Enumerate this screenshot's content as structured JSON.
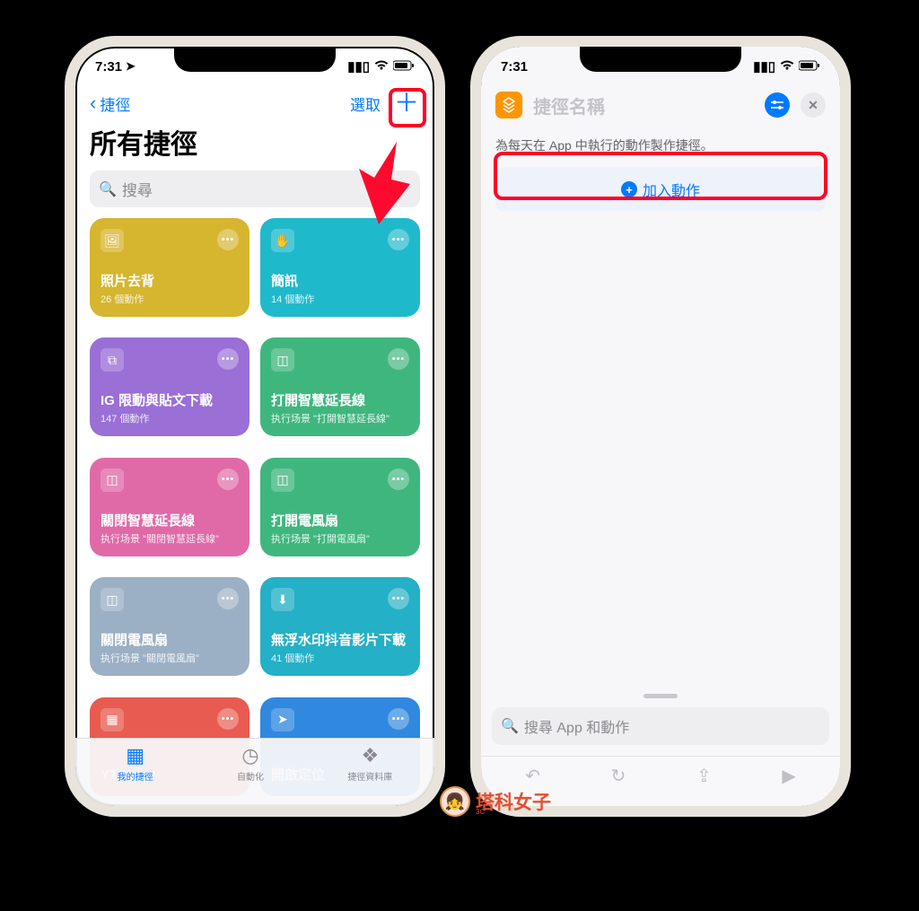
{
  "status": {
    "time": "7:31",
    "loc_icon": "➤"
  },
  "left": {
    "back_label": "捷徑",
    "select_label": "選取",
    "title": "所有捷徑",
    "search_placeholder": "搜尋",
    "tabs": {
      "my": "我的捷徑",
      "automation": "自動化",
      "gallery": "捷徑資料庫"
    },
    "tiles": [
      {
        "title": "照片去背",
        "sub": "26 個動作",
        "color": "#d6b52f",
        "icon": "🖼"
      },
      {
        "title": "簡訊",
        "sub": "14 個動作",
        "color": "#1fb9cc",
        "icon": "✋"
      },
      {
        "title": "IG 限動與貼文下載",
        "sub": "147 個動作",
        "color": "#9a6fd6",
        "icon": "⧉"
      },
      {
        "title": "打開智慧延長線",
        "sub": "执行场景 \"打開智慧延長線\"",
        "color": "#40b67f",
        "icon": "◫"
      },
      {
        "title": "關閉智慧延長線",
        "sub": "执行场景 \"關閉智慧延長線\"",
        "color": "#e06aa8",
        "icon": "◫"
      },
      {
        "title": "打開電風扇",
        "sub": "执行场景 \"打開電風扇\"",
        "color": "#40b67f",
        "icon": "◫"
      },
      {
        "title": "關閉電風扇",
        "sub": "执行场景 \"關閉電風扇\"",
        "color": "#9cb0c5",
        "icon": "◫"
      },
      {
        "title": "無浮水印抖音影片下載",
        "sub": "41 個動作",
        "color": "#24b0c6",
        "icon": "⬇"
      },
      {
        "title": "YTScript",
        "sub": "",
        "color": "#e85b51",
        "icon": "▦"
      },
      {
        "title": "開啟定位",
        "sub": "",
        "color": "#3089de",
        "icon": "➤"
      }
    ]
  },
  "right": {
    "title_placeholder": "捷徑名稱",
    "helper": "為每天在 App 中執行的動作製作捷徑。",
    "add_action": "加入動作",
    "search_placeholder": "搜尋 App 和動作"
  },
  "watermark": {
    "text": "塔科女子",
    "sub": "3C"
  }
}
